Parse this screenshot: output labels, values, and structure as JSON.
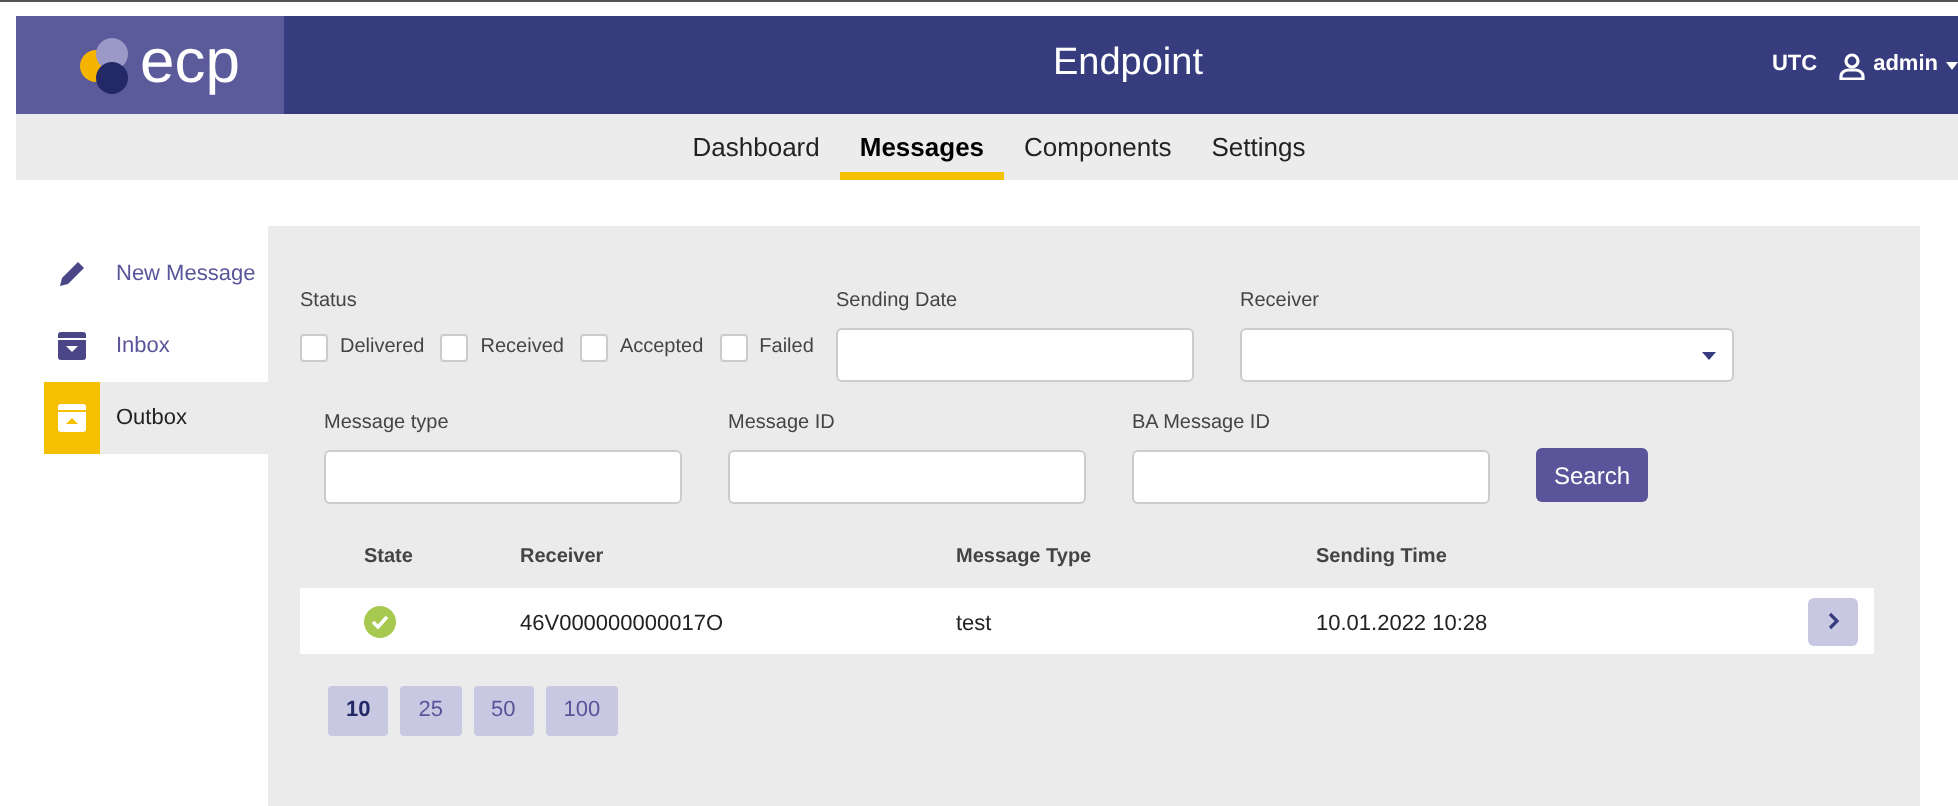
{
  "header": {
    "logo": "ecp",
    "title": "Endpoint",
    "timezone": "UTC",
    "user": "admin"
  },
  "nav": [
    {
      "label": "Dashboard",
      "selected": false
    },
    {
      "label": "Messages",
      "selected": true
    },
    {
      "label": "Components",
      "selected": false
    },
    {
      "label": "Settings",
      "selected": false
    }
  ],
  "sidebar": {
    "items": [
      {
        "label": "New Message",
        "kind": "new",
        "selected": false
      },
      {
        "label": "Inbox",
        "kind": "inbox",
        "selected": false
      },
      {
        "label": "Outbox",
        "kind": "outbox",
        "selected": true
      }
    ]
  },
  "filters": {
    "status_label": "Status",
    "statuses": [
      {
        "label": "Delivered",
        "checked": false
      },
      {
        "label": "Received",
        "checked": false
      },
      {
        "label": "Accepted",
        "checked": false
      },
      {
        "label": "Failed",
        "checked": false
      }
    ],
    "sending_date": {
      "label": "Sending Date"
    },
    "receiver": {
      "label": "Receiver"
    },
    "message_type": {
      "label": "Message type"
    },
    "message_id": {
      "label": "Message ID"
    },
    "ba_message_id": {
      "label": "BA Message ID"
    },
    "search_button": "Search"
  },
  "table": {
    "columns": [
      "State",
      "Receiver",
      "Message Type",
      "Sending Time"
    ],
    "rows": [
      {
        "kind": "delivered",
        "receiver": "46V000000000017O",
        "message_type": "test",
        "sending_time": "10.01.2022 10:28"
      }
    ]
  },
  "page_sizes": [
    {
      "label": "10",
      "selected": true
    },
    {
      "label": "25",
      "selected": false
    },
    {
      "label": "50",
      "selected": false
    },
    {
      "label": "100",
      "selected": false
    }
  ]
}
